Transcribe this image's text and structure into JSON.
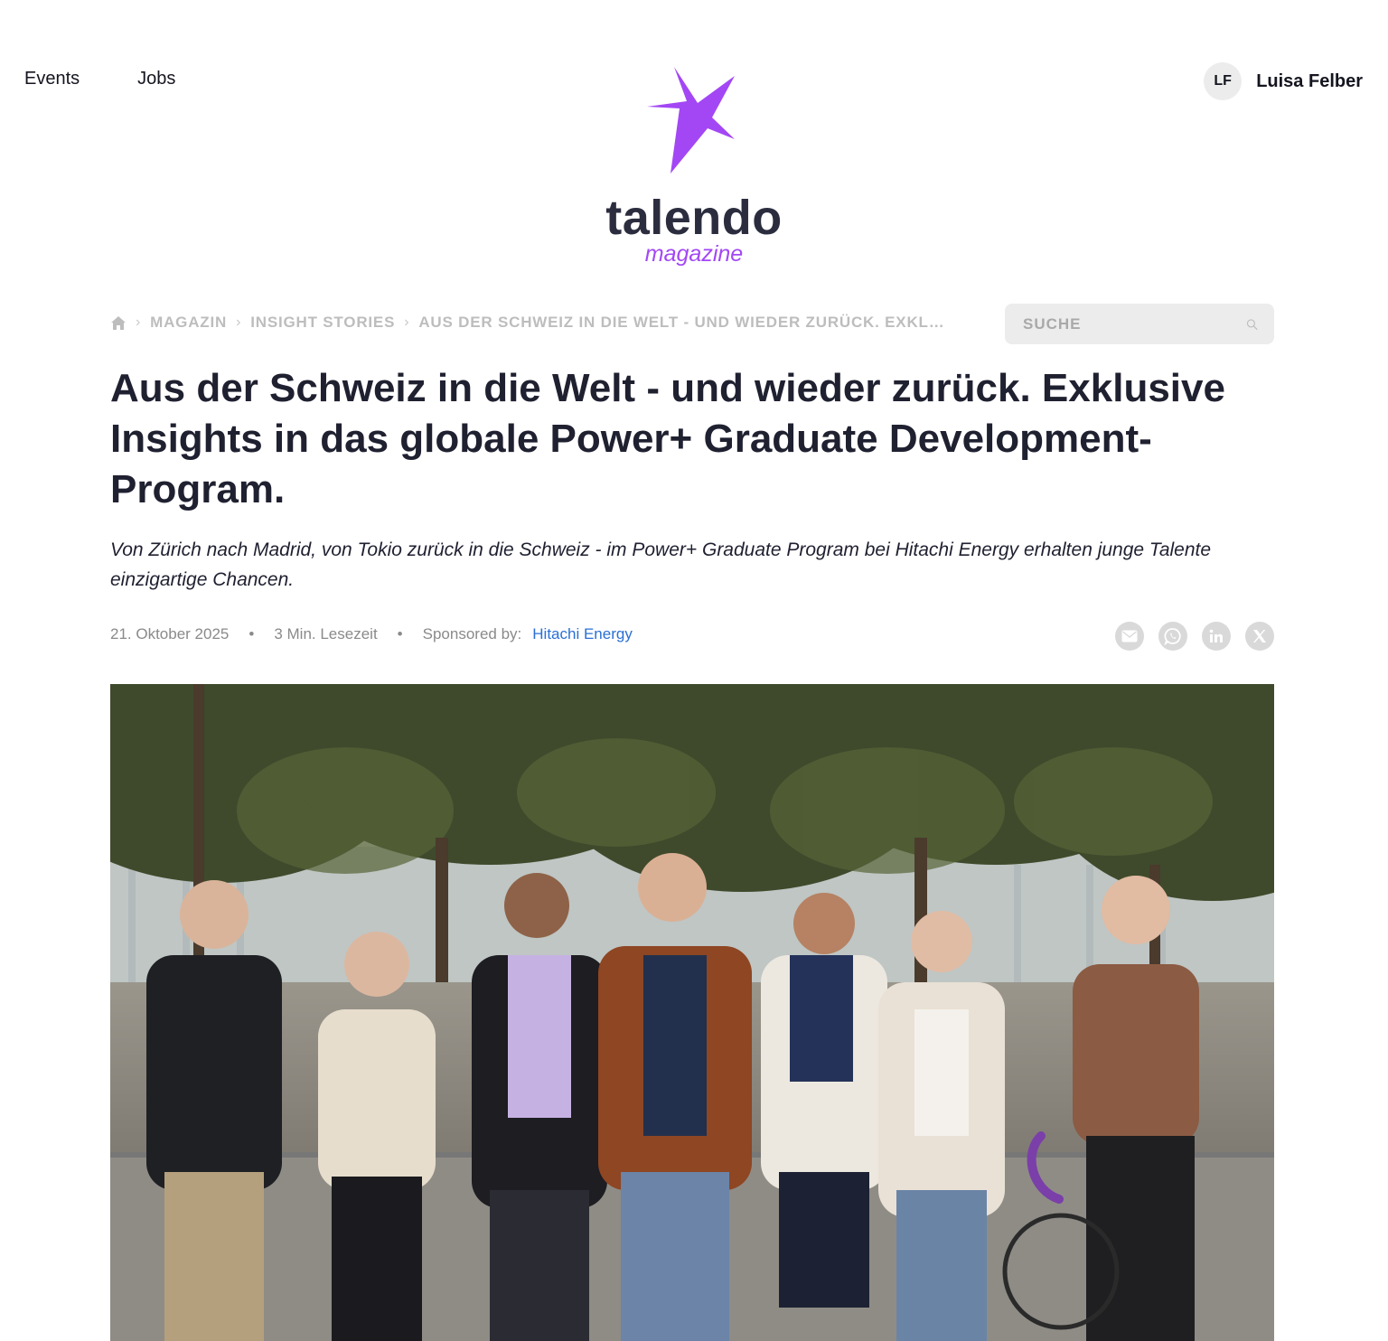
{
  "nav": {
    "events": "Events",
    "jobs": "Jobs"
  },
  "user": {
    "initials": "LF",
    "name": "Luisa Felber"
  },
  "brand": {
    "name": "talendo",
    "subtitle": "magazine",
    "accent": "#a347f5",
    "dark": "#2b2d3f"
  },
  "breadcrumb": {
    "home_icon": "home-icon",
    "items": [
      "MAGAZIN",
      "INSIGHT STORIES"
    ],
    "current": "AUS DER SCHWEIZ IN DIE WELT - UND WIEDER ZURÜCK. EXKLUSIVE INSIGHTS IN DAS GLOBALE POWER+ GRADUATE DEVELOPMENT-PROGRAM."
  },
  "search": {
    "placeholder": "SUCHE",
    "value": "",
    "icon": "search-icon"
  },
  "article": {
    "title": "Aus der Schweiz in die Welt - und wieder zurück. Exklusive Insights in das globale Power+ Graduate Development-Program.",
    "lead": "Von Zürich nach Madrid, von Tokio zurück in die Schweiz - im Power+ Graduate Program bei Hitachi Energy erhalten junge Talente einzigartige Chancen.",
    "date": "21. Oktober 2025",
    "read_time": "3 Min. Lesezeit",
    "sponsored_label": "Sponsored by:",
    "sponsor": "Hitachi Energy",
    "link_color": "#2a6fd6"
  },
  "share": [
    "mail-icon",
    "whatsapp-icon",
    "linkedin-icon",
    "x-icon"
  ]
}
